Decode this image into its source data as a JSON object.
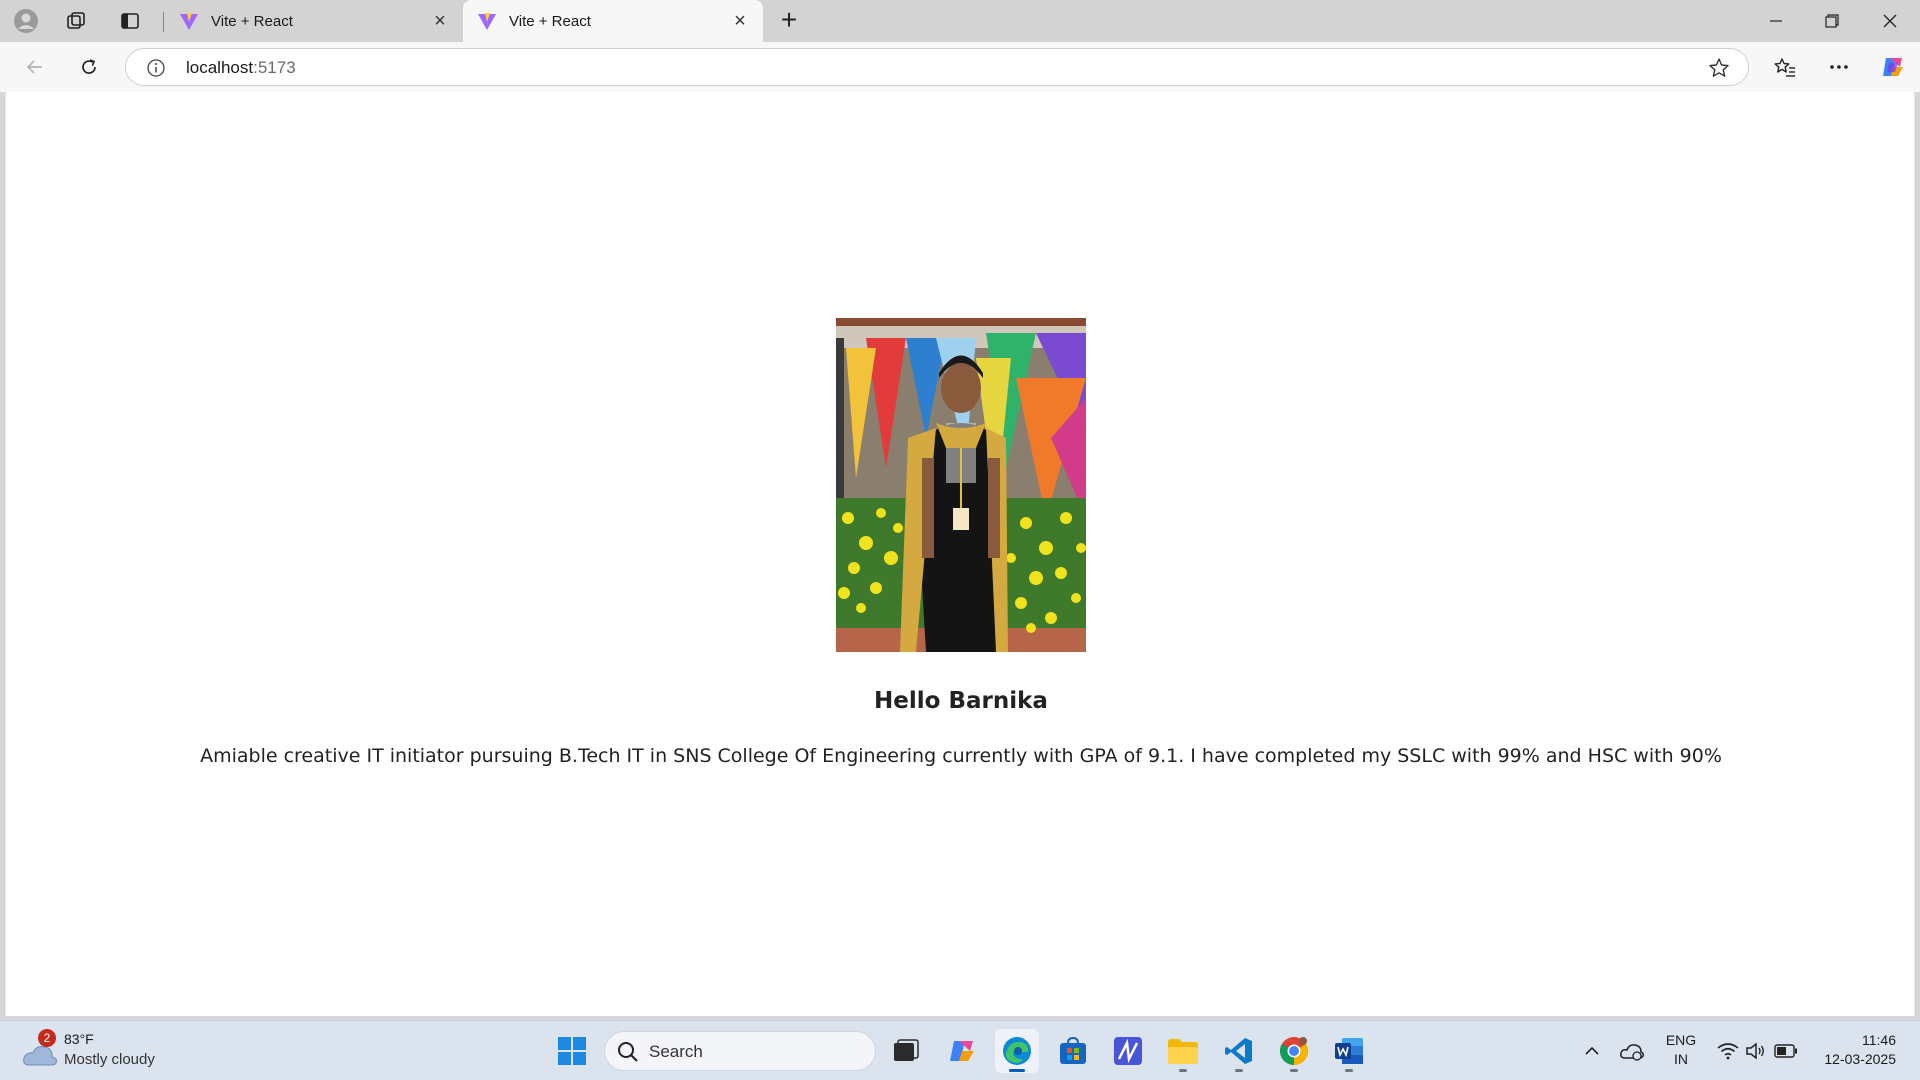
{
  "browser": {
    "tabs": [
      {
        "title": "Vite + React",
        "active": false
      },
      {
        "title": "Vite + React",
        "active": true
      }
    ],
    "address": {
      "host": "localhost",
      "port": ":5173"
    }
  },
  "page": {
    "greeting": "Hello Barnika",
    "bio": "Amiable creative IT initiator pursuing B.Tech IT in SNS College Of Engineering currently with GPA of 9.1. I have completed my SSLC with 99% and HSC with 90%"
  },
  "taskbar": {
    "weather": {
      "badge": "2",
      "temperature": "83°F",
      "condition": "Mostly cloudy"
    },
    "search_label": "Search",
    "language": {
      "line1": "ENG",
      "line2": "IN"
    },
    "clock": {
      "time": "11:46",
      "date": "12-03-2025"
    },
    "apps": [
      "task-view-icon",
      "copilot-icon",
      "edge-icon",
      "store-icon",
      "vibe-icon",
      "file-explorer-icon",
      "vscode-icon",
      "chrome-icon",
      "word-icon"
    ]
  },
  "colors": {
    "accent": "#005fb8",
    "tab_bar": "#d3d3d3",
    "taskbar": "#dbe3ee"
  }
}
